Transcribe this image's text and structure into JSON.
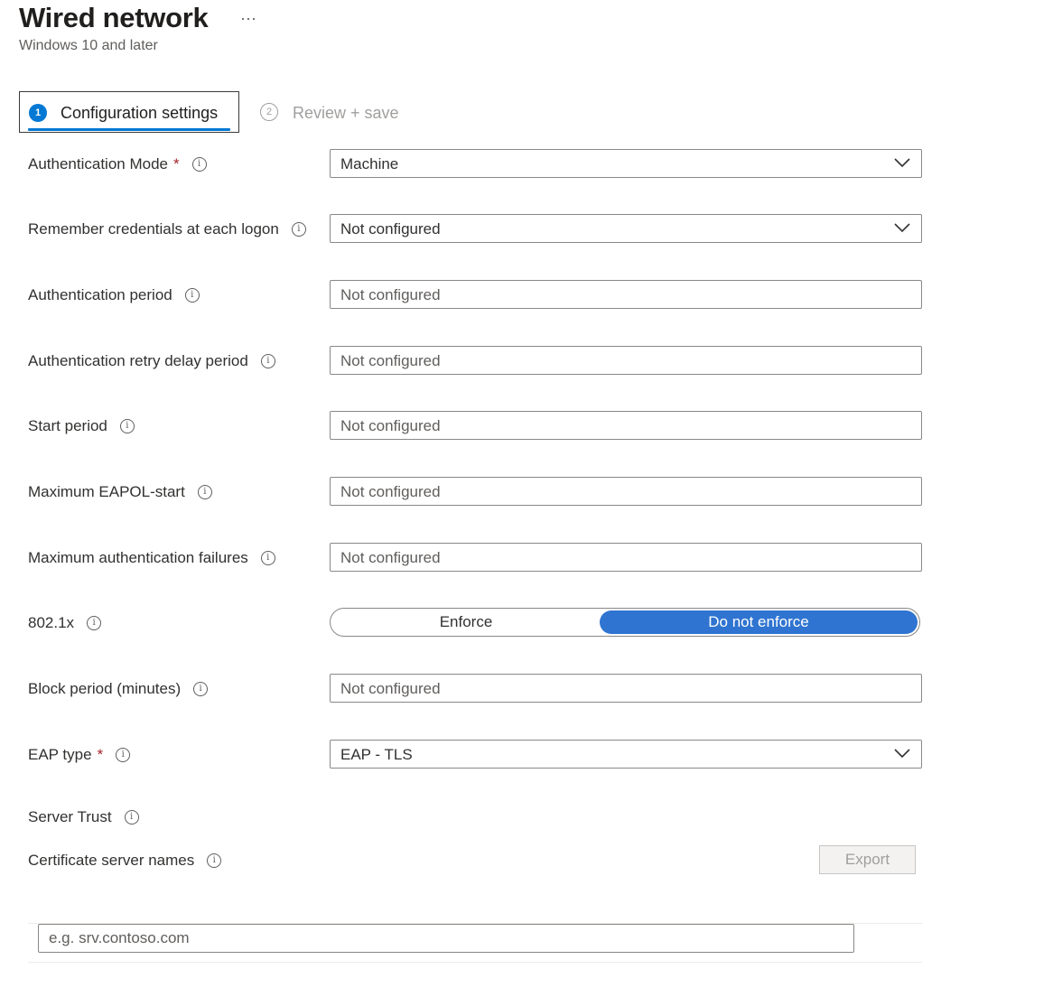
{
  "header": {
    "title": "Wired network",
    "subtitle": "Windows 10 and later",
    "more_label": "···"
  },
  "steps": [
    {
      "number": "1",
      "label": "Configuration settings",
      "active": true
    },
    {
      "number": "2",
      "label": "Review + save",
      "active": false
    }
  ],
  "form": {
    "auth_mode": {
      "label": "Authentication Mode",
      "required": "*",
      "value": "Machine"
    },
    "remember_credentials": {
      "label": "Remember credentials at each logon",
      "value": "Not configured"
    },
    "auth_period": {
      "label": "Authentication period",
      "placeholder": "Not configured"
    },
    "auth_retry_delay": {
      "label": "Authentication retry delay period",
      "placeholder": "Not configured"
    },
    "start_period": {
      "label": "Start period",
      "placeholder": "Not configured"
    },
    "max_eapol_start": {
      "label": "Maximum EAPOL-start",
      "placeholder": "Not configured"
    },
    "max_auth_failures": {
      "label": "Maximum authentication failures",
      "placeholder": "Not configured"
    },
    "dot1x": {
      "label": "802.1x",
      "options": [
        "Enforce",
        "Do not enforce"
      ],
      "selected": "Do not enforce"
    },
    "block_period": {
      "label": "Block period (minutes)",
      "placeholder": "Not configured"
    },
    "eap_type": {
      "label": "EAP type",
      "required": "*",
      "value": "EAP - TLS"
    },
    "server_trust": {
      "label": "Server Trust"
    },
    "cert_server_names": {
      "label": "Certificate server names",
      "export_label": "Export",
      "input_placeholder": "e.g. srv.contoso.com"
    }
  },
  "icons": {
    "info": "info-icon",
    "dropdown": "chevron-down-icon",
    "more": "more-icon"
  },
  "colors": {
    "accent": "#0078d4",
    "toggle_selected": "#2f74d0",
    "required": "#a4262c"
  }
}
